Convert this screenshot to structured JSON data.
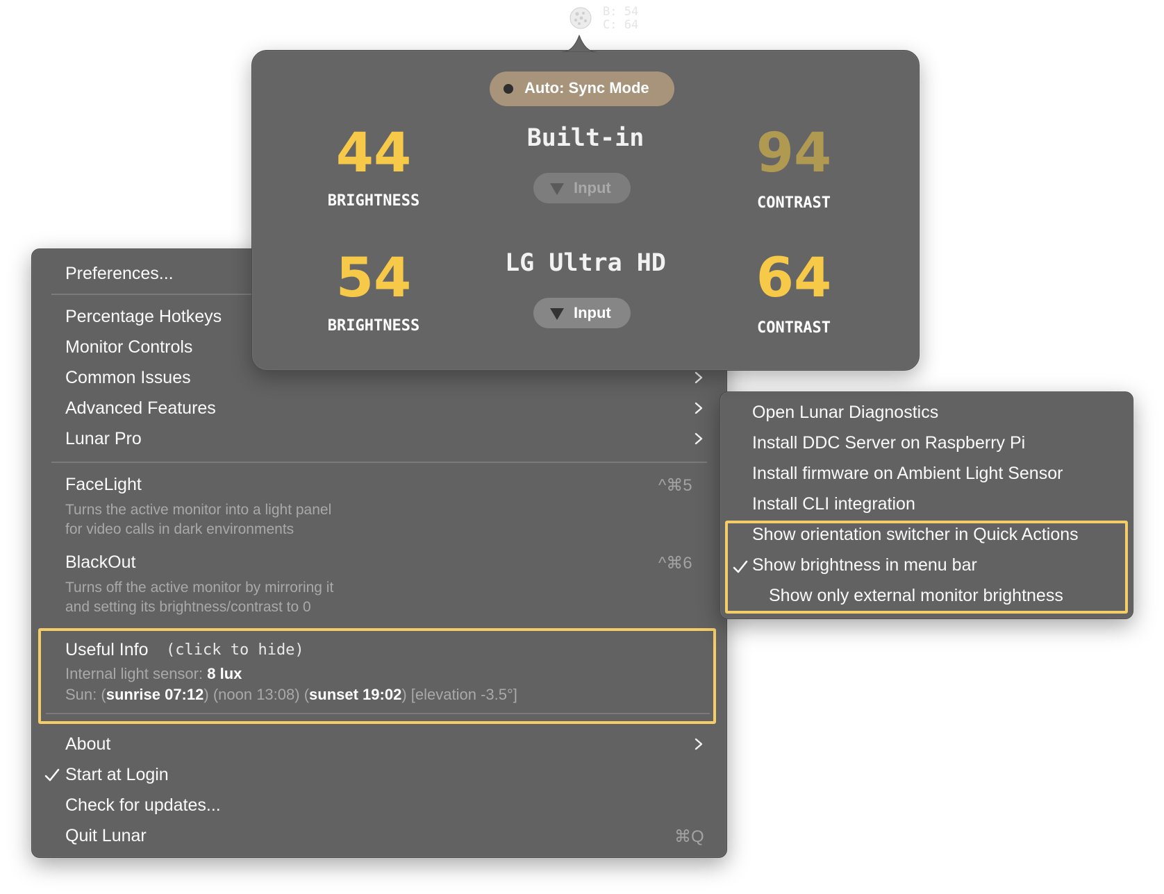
{
  "status_item": {
    "brightness_text": "B: 54",
    "contrast_text": "C: 64"
  },
  "popover": {
    "mode_label": "Auto: Sync Mode",
    "monitors": [
      {
        "name": "Built-in",
        "brightness": "44",
        "brightness_label": "BRIGHTNESS",
        "contrast": "94",
        "contrast_label": "CONTRAST",
        "input_label": "Input",
        "input_enabled": false
      },
      {
        "name": "LG Ultra HD",
        "brightness": "54",
        "brightness_label": "BRIGHTNESS",
        "contrast": "64",
        "contrast_label": "CONTRAST",
        "input_label": "Input",
        "input_enabled": true
      }
    ]
  },
  "main_menu": {
    "preferences": "Preferences...",
    "percentage_hotkeys": "Percentage Hotkeys",
    "monitor_controls": "Monitor Controls",
    "common_issues": "Common Issues",
    "advanced_features": "Advanced Features",
    "lunar_pro": "Lunar Pro",
    "facelight": {
      "label": "FaceLight",
      "shortcut": "^⌘5",
      "desc_line1": "Turns the active monitor into a light panel",
      "desc_line2": "for video calls in dark environments"
    },
    "blackout": {
      "label": "BlackOut",
      "shortcut": "^⌘6",
      "desc_line1": "Turns off the active monitor by mirroring it",
      "desc_line2": "and setting its brightness/contrast to 0"
    },
    "useful_info": {
      "title": "Useful Info",
      "hint": "(click to hide)",
      "sensor_label": "Internal light sensor:",
      "sensor_value": "8 lux",
      "sun_label": "Sun:",
      "paren_open": "(",
      "paren_close": ")",
      "sunrise": "sunrise 07:12",
      "noon": "(noon 13:08)",
      "sunset": "sunset 19:02",
      "elevation": "[elevation -3.5°]"
    },
    "about": "About",
    "start_at_login": "Start at Login",
    "start_at_login_checked": true,
    "check_updates": "Check for updates...",
    "quit": "Quit Lunar",
    "quit_shortcut": "⌘Q"
  },
  "advanced_submenu": {
    "items": [
      "Open Lunar Diagnostics",
      "Install DDC Server on Raspberry Pi",
      "Install firmware on Ambient Light Sensor",
      "Install CLI integration",
      "Show orientation switcher in Quick Actions",
      "Show brightness in menu bar",
      "Show only external monitor brightness"
    ],
    "checked_item": "Show brightness in menu bar"
  },
  "colors": {
    "accent_yellow": "#f7c948",
    "dim_yellow": "#b09a52",
    "highlight_border": "#f4cc68",
    "menu_bg": "#626262",
    "mode_pill": "#a7947a"
  }
}
